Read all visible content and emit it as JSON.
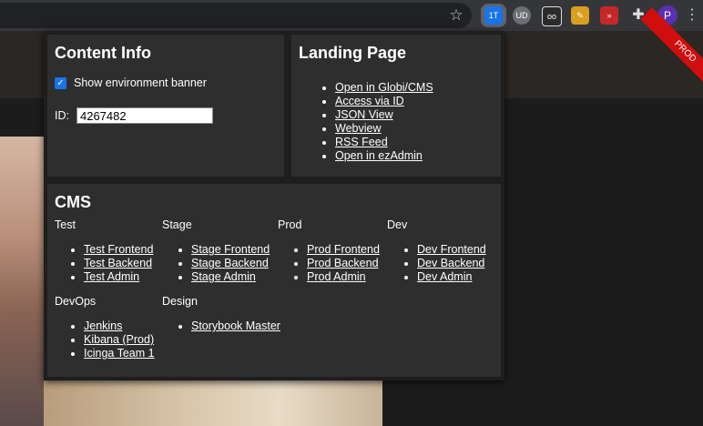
{
  "browser": {
    "profile_initial": "P",
    "extensions": [
      {
        "name": "content-info-extension-icon",
        "label": "1T",
        "color": "#1a73e8"
      },
      {
        "name": "ublock-icon",
        "label": "UD",
        "color": "#6b6e73"
      },
      {
        "name": "tampermonkey-icon",
        "label": "oo",
        "color": "#2b2b2b"
      },
      {
        "name": "highlighter-icon",
        "label": "✎",
        "color": "#d9a020"
      },
      {
        "name": "devtools-extension-icon",
        "label": "»",
        "color": "#c62828"
      }
    ]
  },
  "ribbon": {
    "label": "PROD",
    "color": "#d00e0e"
  },
  "content_info": {
    "title": "Content Info",
    "show_banner_label": "Show environment banner",
    "show_banner_checked": true,
    "id_label": "ID:",
    "id_value": "4267482"
  },
  "landing_page": {
    "title": "Landing Page",
    "links": [
      "Open in Globi/CMS",
      "Access via ID",
      "JSON View",
      "Webview",
      "RSS Feed",
      "Open in ezAdmin"
    ]
  },
  "cms": {
    "title": "CMS",
    "groups": [
      {
        "title": "Test",
        "links": [
          "Test Frontend",
          "Test Backend",
          "Test Admin"
        ]
      },
      {
        "title": "Stage",
        "links": [
          "Stage Frontend",
          "Stage Backend",
          "Stage Admin"
        ]
      },
      {
        "title": "Prod",
        "links": [
          "Prod Frontend",
          "Prod Backend",
          "Prod Admin"
        ]
      },
      {
        "title": "Dev",
        "links": [
          "Dev Frontend",
          "Dev Backend",
          "Dev Admin"
        ]
      },
      {
        "title": "DevOps",
        "links": [
          "Jenkins",
          "Kibana (Prod)",
          "Icinga Team 1"
        ]
      },
      {
        "title": "Design",
        "links": [
          "Storybook Master"
        ]
      }
    ]
  }
}
